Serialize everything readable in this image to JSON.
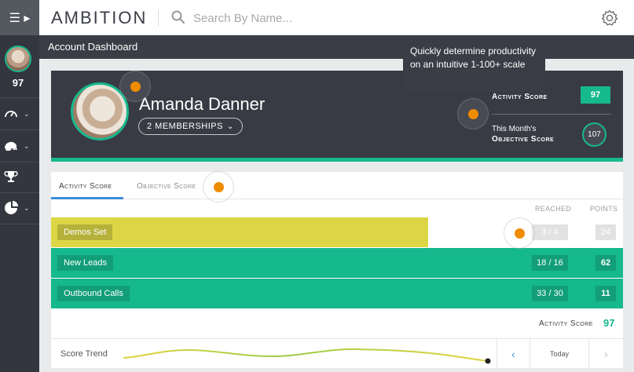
{
  "app": {
    "logo_text": "AMBITION"
  },
  "search": {
    "placeholder": "Search By Name..."
  },
  "sidebar": {
    "score": "97"
  },
  "page": {
    "title": "Account Dashboard"
  },
  "profile": {
    "name": "Amanda Danner",
    "memberships_label": "2 MEMBERSHIPS",
    "activity_label": "Activity Score",
    "activity_value": "97",
    "objective_label_line1": "This Month's",
    "objective_label_line2": "Objective Score",
    "objective_value": "107"
  },
  "tooltip": {
    "text": "Quickly determine productivity on an intuitive 1-100+ scale"
  },
  "tabs": {
    "activity": "Activity Score",
    "objective": "Objective Score"
  },
  "columns": {
    "reached": "REACHED",
    "points": "POINTS"
  },
  "rows": [
    {
      "label": "Demos Set",
      "reached": "3 / 4",
      "points": "24",
      "progress": 0.66
    },
    {
      "label": "New Leads",
      "reached": "18 / 16",
      "points": "62",
      "progress": 1.0
    },
    {
      "label": "Outbound Calls",
      "reached": "33 / 30",
      "points": "11",
      "progress": 1.0
    }
  ],
  "totals": {
    "activity_label": "Activity Score",
    "activity_value": "97"
  },
  "trend": {
    "label": "Score Trend",
    "nav_today": "Today",
    "prev_icon": "chevron-left-icon",
    "next_icon": "chevron-right-icon"
  },
  "colors": {
    "accent": "#16b88d",
    "demos_fill": "#dcd645",
    "hotspot": "#ef8c00",
    "link_blue": "#3b8fd9"
  }
}
